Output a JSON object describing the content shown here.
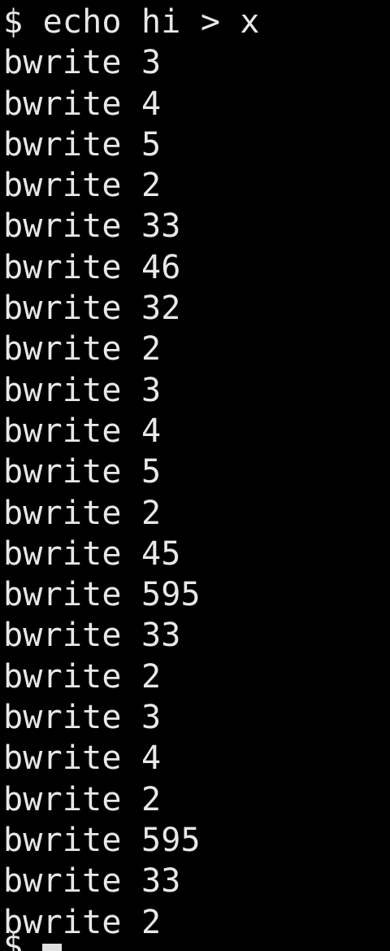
{
  "terminal": {
    "command_line": "$ echo hi > x",
    "output_lines": [
      "bwrite 3",
      "bwrite 4",
      "bwrite 5",
      "bwrite 2",
      "bwrite 33",
      "bwrite 46",
      "bwrite 32",
      "bwrite 2",
      "bwrite 3",
      "bwrite 4",
      "bwrite 5",
      "bwrite 2",
      "bwrite 45",
      "bwrite 595",
      "bwrite 33",
      "bwrite 2",
      "bwrite 3",
      "bwrite 4",
      "bwrite 2",
      "bwrite 595",
      "bwrite 33",
      "bwrite 2"
    ],
    "next_prompt": "$",
    "colors": {
      "background": "#000000",
      "foreground": "#e8e8e8"
    }
  }
}
